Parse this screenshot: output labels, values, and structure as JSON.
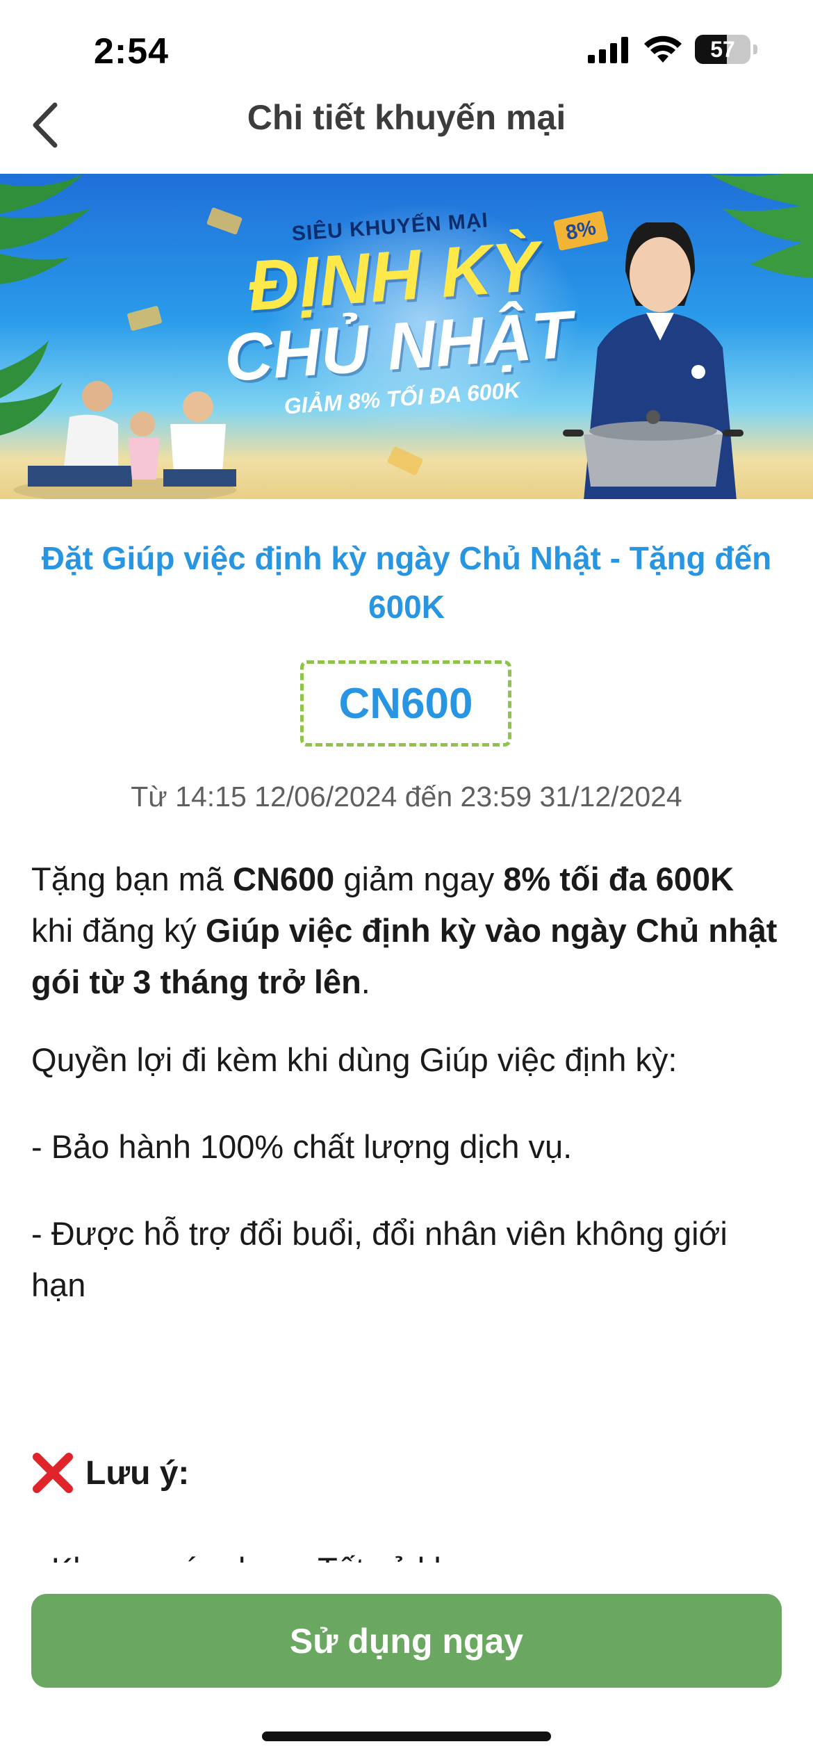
{
  "status_bar": {
    "time": "2:54",
    "battery": "57",
    "icons": [
      "signal-icon",
      "wifi-icon",
      "battery-icon"
    ]
  },
  "nav": {
    "title": "Chi tiết khuyến mại",
    "back_icon": "chevron-left-icon"
  },
  "banner": {
    "kicker": "SIÊU KHUYẾN MẠI",
    "headline_1": "ĐỊNH KỲ",
    "headline_2": "CHỦ NHẬT",
    "subline": "GIẢM 8% TỐI ĐA 600K",
    "tag": "8%"
  },
  "promo": {
    "title": "Đặt Giúp việc định kỳ ngày Chủ Nhật - Tặng đến 600K",
    "code": "CN600",
    "validity": "Từ 14:15 12/06/2024 đến 23:59 31/12/2024",
    "description": {
      "p1": "Tặng bạn mã ",
      "code": "CN600",
      "p2": " giảm ngay ",
      "discount": "8% tối đa 600K",
      "p3": " khi đăng ký ",
      "service": "Giúp việc định kỳ vào ngày Chủ nhật gói từ 3 tháng trở lên",
      "p4": "."
    },
    "benefits_heading": "Quyền lợi đi kèm khi dùng Giúp việc định kỳ:",
    "benefit_1": "- Bảo hành 100% chất lượng dịch vụ.",
    "benefit_2": "- Được hỗ trợ đổi buổi, đổi nhân viên không giới hạn",
    "note_label": "Lưu ý:",
    "note_line_partial": "- Khu vực áp dụng: Tất cả khu vực"
  },
  "cta": {
    "label": "Sử dụng ngay",
    "color": "#6aa760"
  },
  "colors": {
    "accent_blue": "#2895e3",
    "dashed_border": "#8ec44c"
  }
}
